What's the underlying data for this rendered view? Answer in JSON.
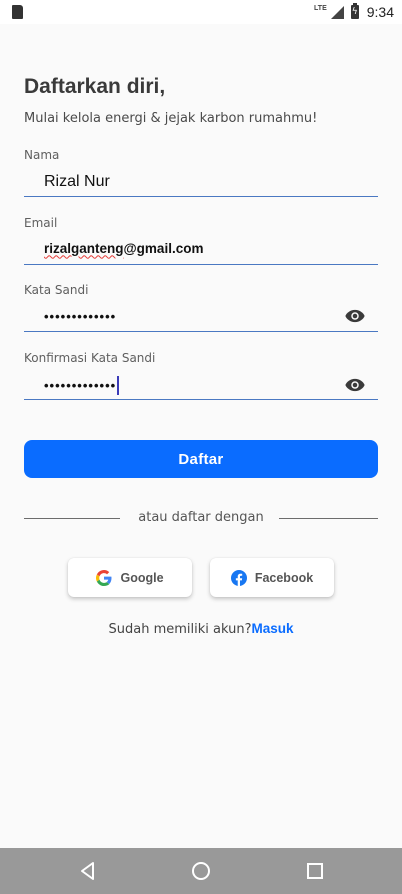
{
  "status_bar": {
    "network": "LTE",
    "time": "9:34"
  },
  "header": {
    "title": "Daftarkan diri,",
    "subtitle": "Mulai kelola energi & jejak karbon rumahmu!"
  },
  "form": {
    "name": {
      "label": "Nama",
      "value": "Rizal Nur"
    },
    "email": {
      "label": "Email",
      "value_misspelled": "rizalganteng",
      "value_rest": "@gmail.com"
    },
    "password": {
      "label": "Kata Sandi",
      "masked_value": "•••••••••••••"
    },
    "confirm_password": {
      "label": "Konfirmasi Kata Sandi",
      "masked_value": "•••••••••••••"
    }
  },
  "actions": {
    "register_label": "Daftar",
    "divider_text": "atau daftar dengan",
    "google_label": "Google",
    "facebook_label": "Facebook",
    "login_prompt": "Sudah memiliki akun?",
    "login_link": "Masuk"
  },
  "icons": {
    "eye": "eye-icon",
    "google": "google-icon",
    "facebook": "facebook-icon"
  },
  "colors": {
    "primary": "#0a6cff",
    "field_underline": "#4a78c2",
    "background": "#fafafa",
    "navbar": "#999999"
  }
}
